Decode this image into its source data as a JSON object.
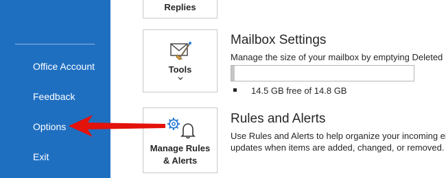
{
  "nav": {
    "items": [
      {
        "label": "Office Account"
      },
      {
        "label": "Feedback"
      },
      {
        "label": "Options"
      },
      {
        "label": "Exit"
      }
    ]
  },
  "tiles": {
    "replies": {
      "label": "Replies"
    },
    "tools": {
      "label": "Tools",
      "icon": "mailbox-cleanup-icon",
      "dropdown_icon": "chevron-down-icon"
    },
    "rules": {
      "line1": "Manage Rules",
      "line2": "& Alerts",
      "icon": "rules-alerts-icon"
    }
  },
  "mailbox": {
    "title": "Mailbox Settings",
    "description": "Manage the size of your mailbox by emptying Deleted",
    "usage_text": "14.5 GB free of 14.8 GB",
    "used_fraction": 0.02
  },
  "rules": {
    "title": "Rules and Alerts",
    "description_line1": "Use Rules and Alerts to help organize your incoming en",
    "description_line2": "updates when items are added, changed, or removed."
  },
  "annotation": {
    "type": "red-arrow",
    "points_to": "Options",
    "color": "#e3120b"
  },
  "colors": {
    "nav_background": "#1f6fc1",
    "accent_icon": "#2b7cd3"
  }
}
